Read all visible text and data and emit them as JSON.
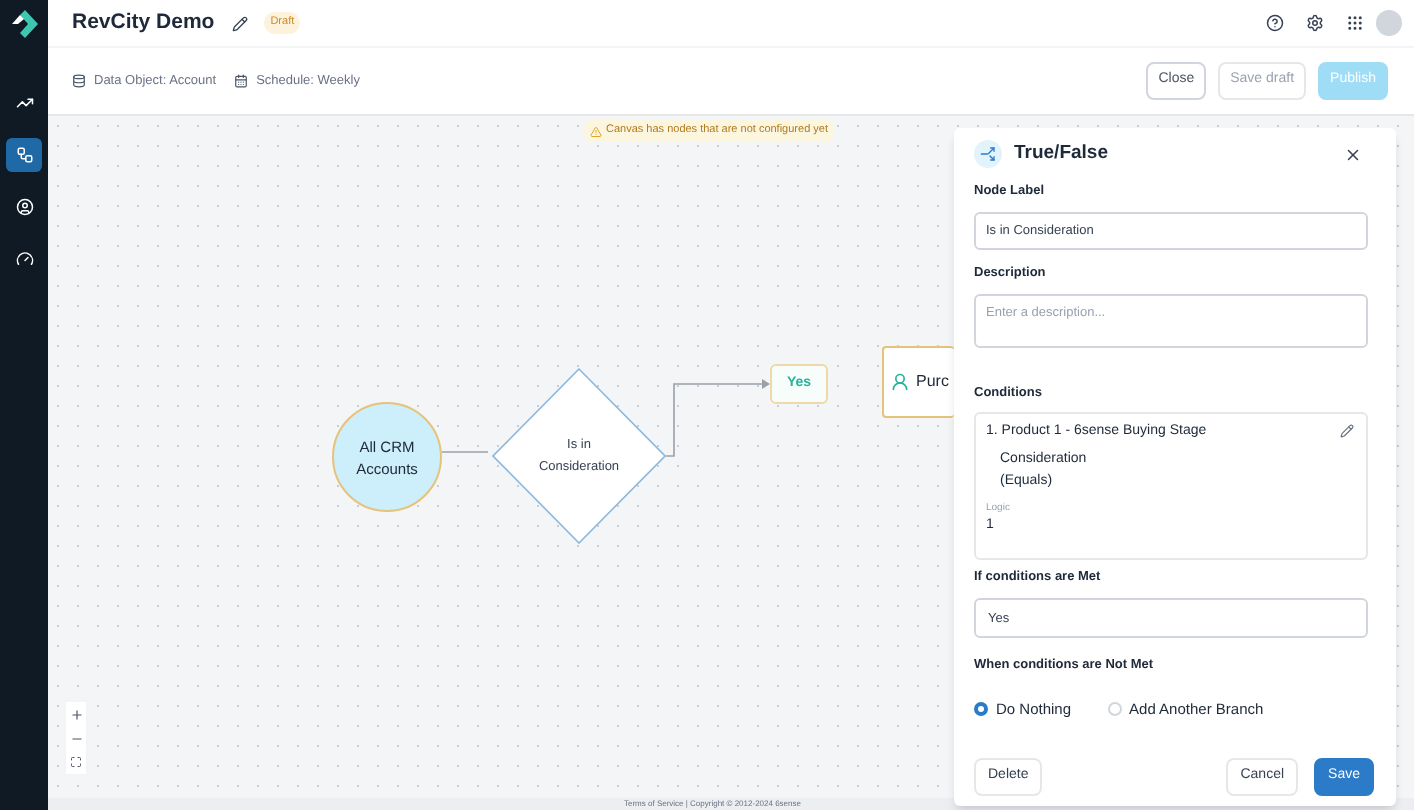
{
  "header": {
    "title": "RevCity Demo",
    "status": "Draft",
    "data_object": "Data Object: Account",
    "schedule": "Schedule: Weekly",
    "buttons": [
      {
        "label": "Close",
        "disabled": false,
        "kind": "outline"
      },
      {
        "label": "Save draft",
        "disabled": true,
        "kind": "outline"
      },
      {
        "label": "Publish",
        "disabled": true,
        "kind": "primary"
      }
    ]
  },
  "sidebar": {
    "items": [
      {
        "kind": "trend",
        "selected": false
      },
      {
        "kind": "flow",
        "selected": true
      },
      {
        "kind": "user",
        "selected": false
      },
      {
        "kind": "gauge",
        "selected": false
      }
    ]
  },
  "canvas": {
    "warning": "Canvas has nodes that are not configured yet",
    "nodes": [
      {
        "kind": "start",
        "label": "All CRM Accounts"
      },
      {
        "kind": "condition",
        "label": "Is in Consideration"
      },
      {
        "kind": "branch",
        "label": "Yes"
      },
      {
        "kind": "action",
        "label": "Purc"
      }
    ],
    "footer": "Terms of Service | Copyright © 2012-2024 6sense"
  },
  "panel": {
    "title": "True/False",
    "node_label": {
      "label": "Node Label",
      "value": "Is in Consideration"
    },
    "description": {
      "label": "Description",
      "placeholder": "Enter a description..."
    },
    "conditions": {
      "label": "Conditions",
      "items": [
        {
          "title": "1. Product 1 - 6sense Buying Stage",
          "value": "Consideration",
          "operator": "(Equals)"
        }
      ],
      "logic_label": "Logic",
      "logic": "1"
    },
    "met": {
      "label": "If conditions are Met",
      "value": "Yes"
    },
    "not_met": {
      "label": "When conditions are Not Met",
      "options": [
        {
          "label": "Do Nothing",
          "selected": true
        },
        {
          "label": "Add Another Branch",
          "selected": false
        }
      ]
    },
    "buttons": [
      {
        "label": "Delete",
        "kind": "outline"
      },
      {
        "label": "Cancel",
        "kind": "outline"
      },
      {
        "label": "Save",
        "kind": "primary"
      }
    ]
  }
}
